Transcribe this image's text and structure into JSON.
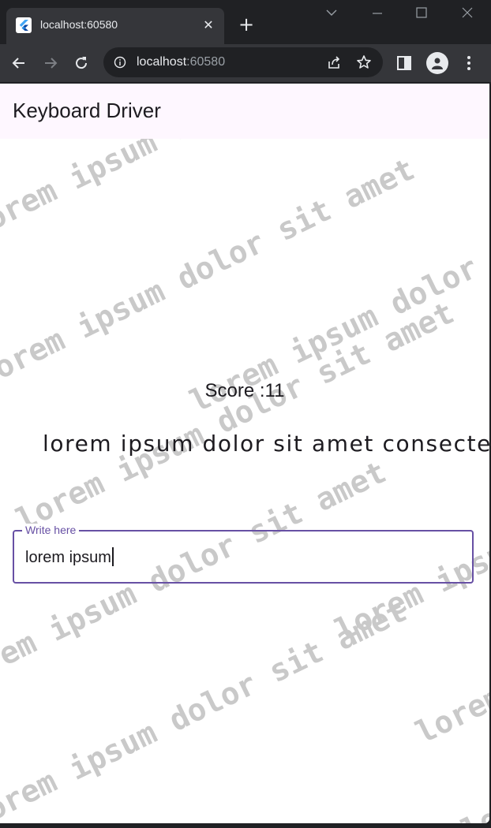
{
  "browser": {
    "tab_title": "localhost:60580",
    "url_host": "localhost",
    "url_port": ":60580"
  },
  "app": {
    "title": "Keyboard Driver"
  },
  "game": {
    "score_label": "Score :11",
    "target_text": "lorem ipsum dolor sit amet consectetur",
    "input_label": "Write here",
    "input_value": "lorem ipsum"
  },
  "background_watermark": {
    "text": "lorem ipsum dolor sit amet"
  },
  "colors": {
    "accent": "#6750a4",
    "appbar_bg": "#fef7ff",
    "watermark": "#c9c9c9"
  }
}
